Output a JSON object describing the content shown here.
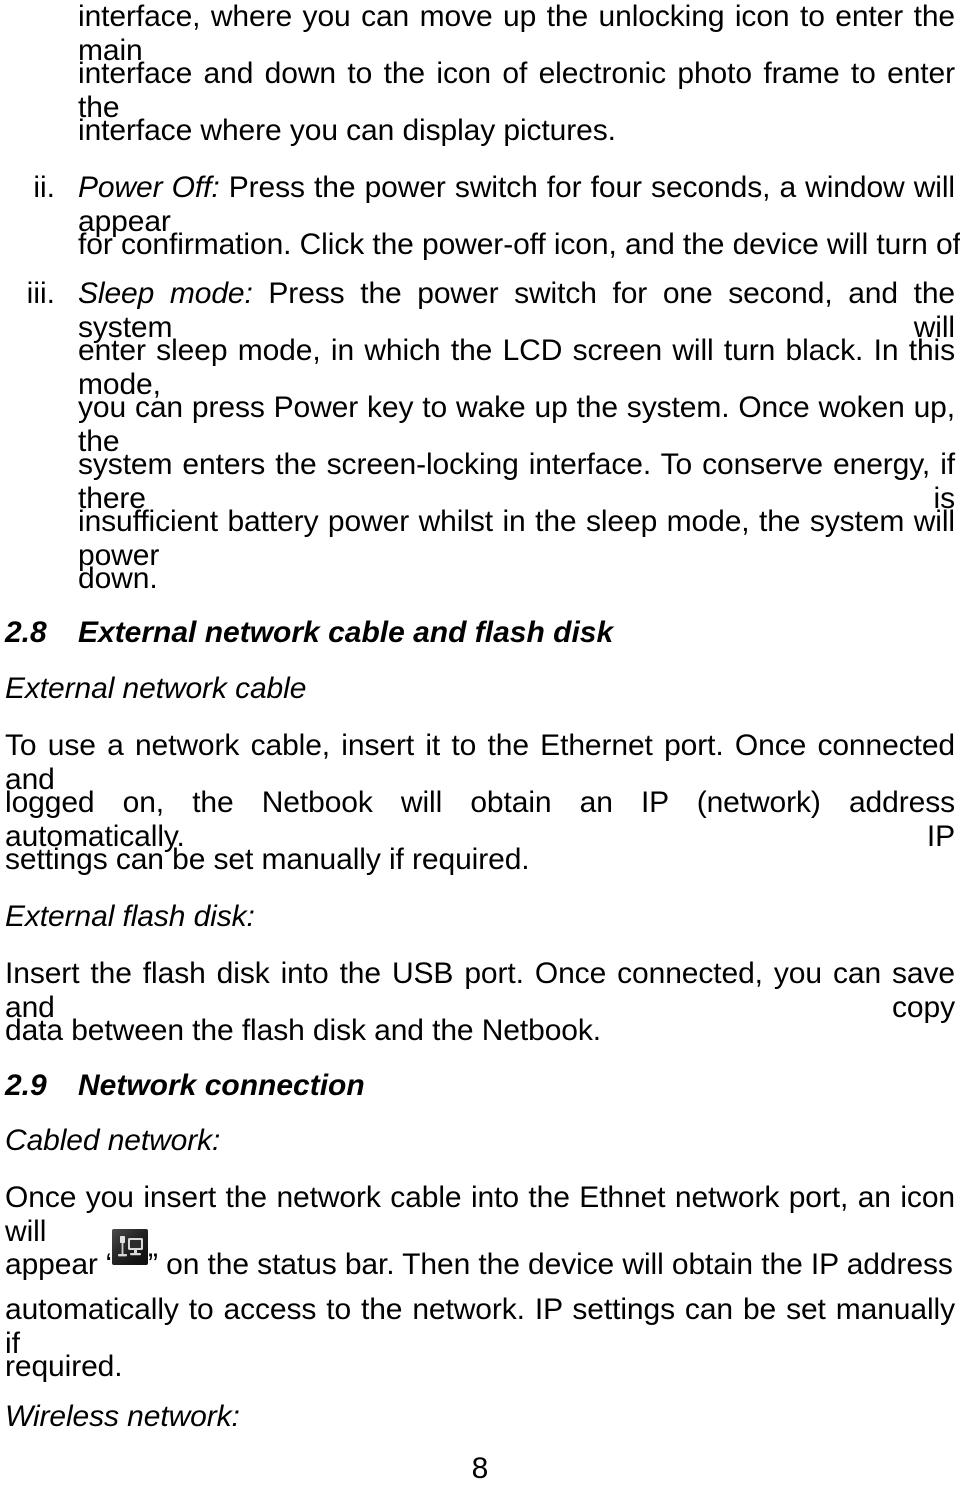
{
  "document": {
    "page_number": "8",
    "background_color": "#ffffff",
    "text_color": "#000000"
  },
  "body": {
    "para_intro": {
      "lines": [
        "interface, where you can move up the unlocking icon to enter the main",
        "interface and down to the icon of electronic photo frame to enter the",
        "interface where you can display pictures."
      ]
    },
    "list_items": [
      {
        "marker": "ii.",
        "term": "Power Off:",
        "lines": [
          "Press the power switch for four seconds, a window will appear",
          "for confirmation. Click the power-off icon, and the device will turn off."
        ]
      },
      {
        "marker": "iii.",
        "term": "Sleep mode:",
        "lines": [
          "Press the power switch for one second, and the system will",
          "enter sleep mode, in which the LCD screen will turn black. In this mode,",
          "you can press Power key to wake up the system. Once woken up, the",
          "system enters the screen-locking interface. To conserve energy, if there is",
          "insufficient battery power whilst in the sleep mode, the system will power",
          "down."
        ]
      }
    ],
    "section_2_8": {
      "number": "2.8",
      "title": "External network cable and flash disk",
      "sub1_heading": "External network cable",
      "sub1_lines": [
        "To use a network cable, insert it to the Ethernet port.   Once connected and",
        "logged on, the Netbook will obtain an IP (network) address automatically.   IP",
        "settings can be set manually if required."
      ],
      "sub2_heading": "External flash disk:",
      "sub2_lines": [
        "Insert the flash disk into the USB port. Once connected, you can save and copy",
        "data between the flash disk and the Netbook."
      ]
    },
    "section_2_9": {
      "number": "2.9",
      "title": "Network connection",
      "sub1_heading": "Cabled network:",
      "sub1_line1": "Once you insert the network cable into the Ethnet network port, an icon will",
      "sub1_line2_before": "appear ",
      "sub1_quote_open": "“",
      "sub1_icon_name": "network-connected-icon",
      "sub1_quote_close": "”",
      "sub1_line2_after": " on the status bar. Then the device will obtain the IP address",
      "sub1_line3": "automatically to access to the network. IP settings can be set manually if",
      "sub1_line4": "required.",
      "sub2_heading": "Wireless network:"
    }
  }
}
